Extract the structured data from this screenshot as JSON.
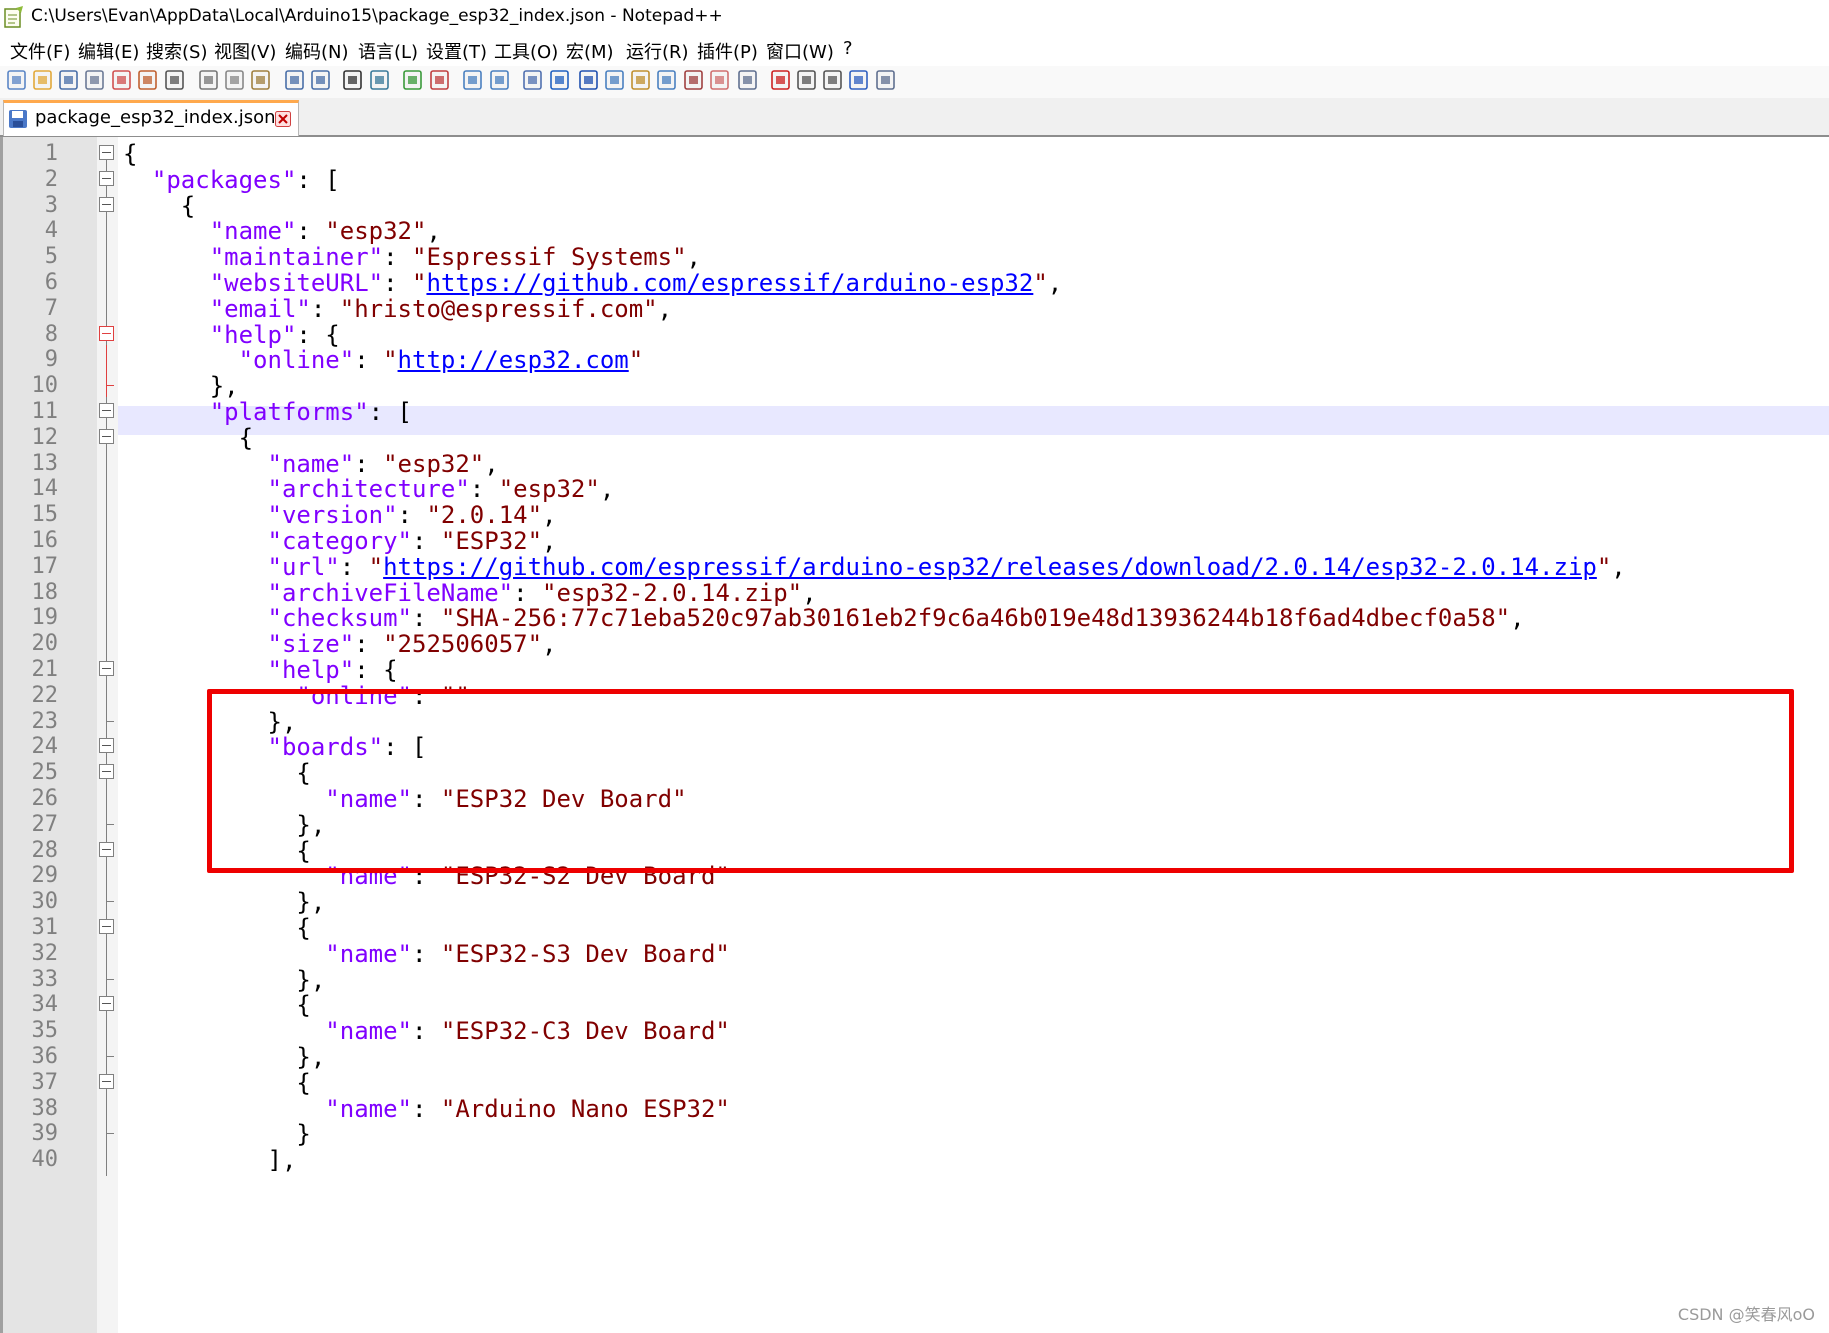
{
  "window": {
    "title": "C:\\Users\\Evan\\AppData\\Local\\Arduino15\\package_esp32_index.json - Notepad++"
  },
  "menu": [
    "文件(F)",
    "编辑(E)",
    "搜索(S)",
    "视图(V)",
    "编码(N)",
    "语言(L)",
    "设置(T)",
    "工具(O)",
    "宏(M)",
    "运行(R)",
    "插件(P)",
    "窗口(W)",
    "?"
  ],
  "toolbar_icons": [
    "new-file-icon",
    "open-file-icon",
    "save-icon",
    "save-all-icon",
    "close-icon",
    "close-all-icon",
    "print-icon",
    "cut-icon",
    "copy-icon",
    "paste-icon",
    "undo-icon",
    "redo-icon",
    "find-icon",
    "replace-icon",
    "zoom-in-icon",
    "zoom-out-icon",
    "sync-vertical-icon",
    "sync-horizontal-icon",
    "word-wrap-icon",
    "show-all-chars-icon",
    "indent-guide-icon",
    "document-map-icon",
    "function-list-icon",
    "folder-as-workspace-icon",
    "monitoring-icon",
    "user-defined-language-icon",
    "eye-icon",
    "record-macro-icon",
    "stop-macro-icon",
    "play-macro-icon",
    "run-macro-multiple-icon",
    "save-macro-icon"
  ],
  "tab": {
    "label": "package_esp32_index.json"
  },
  "colors": {
    "key": "#8000ff",
    "string": "#800000",
    "url": "#0000ff",
    "highlight_border": "#ee0000",
    "current_line": "#e8e8ff"
  },
  "lines": [
    {
      "n": "1",
      "tokens": [
        [
          "p",
          "{"
        ]
      ]
    },
    {
      "n": "2",
      "tokens": [
        [
          "k",
          "  \"packages\""
        ],
        [
          "p",
          ": ["
        ]
      ]
    },
    {
      "n": "3",
      "tokens": [
        [
          "p",
          "    {"
        ]
      ]
    },
    {
      "n": "4",
      "tokens": [
        [
          "k",
          "      \"name\""
        ],
        [
          "p",
          ": "
        ],
        [
          "v",
          "\"esp32\""
        ],
        [
          "p",
          ","
        ]
      ]
    },
    {
      "n": "5",
      "tokens": [
        [
          "k",
          "      \"maintainer\""
        ],
        [
          "p",
          ": "
        ],
        [
          "v",
          "\"Espressif Systems\""
        ],
        [
          "p",
          ","
        ]
      ]
    },
    {
      "n": "6",
      "tokens": [
        [
          "k",
          "      \"websiteURL\""
        ],
        [
          "p",
          ": "
        ],
        [
          "v",
          "\""
        ],
        [
          "u",
          "https://github.com/espressif/arduino-esp32"
        ],
        [
          "v",
          "\""
        ],
        [
          "p",
          ","
        ]
      ]
    },
    {
      "n": "7",
      "tokens": [
        [
          "k",
          "      \"email\""
        ],
        [
          "p",
          ": "
        ],
        [
          "v",
          "\"hristo@espressif.com\""
        ],
        [
          "p",
          ","
        ]
      ]
    },
    {
      "n": "8",
      "tokens": [
        [
          "k",
          "      \"help\""
        ],
        [
          "p",
          ": {"
        ]
      ]
    },
    {
      "n": "9",
      "tokens": [
        [
          "k",
          "        \"online\""
        ],
        [
          "p",
          ": "
        ],
        [
          "v",
          "\""
        ],
        [
          "u",
          "http://esp32.com"
        ],
        [
          "v",
          "\""
        ]
      ]
    },
    {
      "n": "10",
      "tokens": [
        [
          "p",
          "      },"
        ]
      ]
    },
    {
      "n": "11",
      "tokens": [
        [
          "k",
          "      \"platforms\""
        ],
        [
          "p",
          ": ["
        ]
      ]
    },
    {
      "n": "12",
      "tokens": [
        [
          "p",
          "        {"
        ]
      ]
    },
    {
      "n": "13",
      "tokens": [
        [
          "k",
          "          \"name\""
        ],
        [
          "p",
          ": "
        ],
        [
          "v",
          "\"esp32\""
        ],
        [
          "p",
          ","
        ]
      ]
    },
    {
      "n": "14",
      "tokens": [
        [
          "k",
          "          \"architecture\""
        ],
        [
          "p",
          ": "
        ],
        [
          "v",
          "\"esp32\""
        ],
        [
          "p",
          ","
        ]
      ]
    },
    {
      "n": "15",
      "tokens": [
        [
          "k",
          "          \"version\""
        ],
        [
          "p",
          ": "
        ],
        [
          "v",
          "\"2.0.14\""
        ],
        [
          "p",
          ","
        ]
      ]
    },
    {
      "n": "16",
      "tokens": [
        [
          "k",
          "          \"category\""
        ],
        [
          "p",
          ": "
        ],
        [
          "v",
          "\"ESP32\""
        ],
        [
          "p",
          ","
        ]
      ]
    },
    {
      "n": "17",
      "tokens": [
        [
          "k",
          "          \"url\""
        ],
        [
          "p",
          ": "
        ],
        [
          "v",
          "\""
        ],
        [
          "u",
          "https://github.com/espressif/arduino-esp32/releases/download/2.0.14/esp32-2.0.14.zip"
        ],
        [
          "v",
          "\""
        ],
        [
          "p",
          ","
        ]
      ]
    },
    {
      "n": "18",
      "tokens": [
        [
          "k",
          "          \"archiveFileName\""
        ],
        [
          "p",
          ": "
        ],
        [
          "v",
          "\"esp32-2.0.14.zip\""
        ],
        [
          "p",
          ","
        ]
      ]
    },
    {
      "n": "19",
      "tokens": [
        [
          "k",
          "          \"checksum\""
        ],
        [
          "p",
          ": "
        ],
        [
          "v",
          "\"SHA-256:77c71eba520c97ab30161eb2f9c6a46b019e48d13936244b18f6ad4dbecf0a58\""
        ],
        [
          "p",
          ","
        ]
      ]
    },
    {
      "n": "20",
      "tokens": [
        [
          "k",
          "          \"size\""
        ],
        [
          "p",
          ": "
        ],
        [
          "v",
          "\"252506057\""
        ],
        [
          "p",
          ","
        ]
      ]
    },
    {
      "n": "21",
      "tokens": [
        [
          "k",
          "          \"help\""
        ],
        [
          "p",
          ": {"
        ]
      ]
    },
    {
      "n": "22",
      "tokens": [
        [
          "k",
          "            \"online\""
        ],
        [
          "p",
          ": "
        ],
        [
          "v",
          "\"\""
        ]
      ]
    },
    {
      "n": "23",
      "tokens": [
        [
          "p",
          "          },"
        ]
      ]
    },
    {
      "n": "24",
      "tokens": [
        [
          "k",
          "          \"boards\""
        ],
        [
          "p",
          ": ["
        ]
      ]
    },
    {
      "n": "25",
      "tokens": [
        [
          "p",
          "            {"
        ]
      ]
    },
    {
      "n": "26",
      "tokens": [
        [
          "k",
          "              \"name\""
        ],
        [
          "p",
          ": "
        ],
        [
          "v",
          "\"ESP32 Dev Board\""
        ]
      ]
    },
    {
      "n": "27",
      "tokens": [
        [
          "p",
          "            },"
        ]
      ]
    },
    {
      "n": "28",
      "tokens": [
        [
          "p",
          "            {"
        ]
      ]
    },
    {
      "n": "29",
      "tokens": [
        [
          "k",
          "              \"name\""
        ],
        [
          "p",
          ": "
        ],
        [
          "v",
          "\"ESP32-S2 Dev Board\""
        ]
      ]
    },
    {
      "n": "30",
      "tokens": [
        [
          "p",
          "            },"
        ]
      ]
    },
    {
      "n": "31",
      "tokens": [
        [
          "p",
          "            {"
        ]
      ]
    },
    {
      "n": "32",
      "tokens": [
        [
          "k",
          "              \"name\""
        ],
        [
          "p",
          ": "
        ],
        [
          "v",
          "\"ESP32-S3 Dev Board\""
        ]
      ]
    },
    {
      "n": "33",
      "tokens": [
        [
          "p",
          "            },"
        ]
      ]
    },
    {
      "n": "34",
      "tokens": [
        [
          "p",
          "            {"
        ]
      ]
    },
    {
      "n": "35",
      "tokens": [
        [
          "k",
          "              \"name\""
        ],
        [
          "p",
          ": "
        ],
        [
          "v",
          "\"ESP32-C3 Dev Board\""
        ]
      ]
    },
    {
      "n": "36",
      "tokens": [
        [
          "p",
          "            },"
        ]
      ]
    },
    {
      "n": "37",
      "tokens": [
        [
          "p",
          "            {"
        ]
      ]
    },
    {
      "n": "38",
      "tokens": [
        [
          "k",
          "              \"name\""
        ],
        [
          "p",
          ": "
        ],
        [
          "v",
          "\"Arduino Nano ESP32\""
        ]
      ]
    },
    {
      "n": "39",
      "tokens": [
        [
          "p",
          "            }"
        ]
      ]
    },
    {
      "n": "40",
      "tokens": [
        [
          "p",
          "          ],"
        ]
      ]
    }
  ],
  "fold_markers": {
    "open": [
      "1",
      "2",
      "3",
      "11",
      "12",
      "21",
      "24",
      "25",
      "28",
      "31",
      "34",
      "37"
    ],
    "open_red": [
      "8"
    ],
    "end": [
      "23",
      "27",
      "30",
      "33",
      "36",
      "39"
    ],
    "end_red": [
      "10"
    ]
  },
  "watermark": "CSDN @笑春风oO"
}
